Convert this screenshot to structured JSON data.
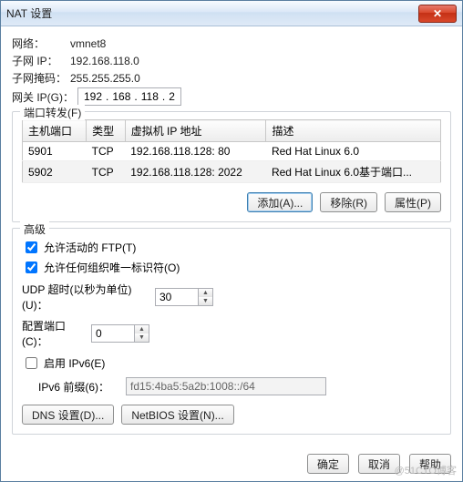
{
  "window": {
    "title": "NAT 设置"
  },
  "network_label": "网络：",
  "network_value": "vmnet8",
  "subnet_ip_label": "子网 IP：",
  "subnet_ip_value": "192.168.118.0",
  "subnet_mask_label": "子网掩码：",
  "subnet_mask_value": "255.255.255.0",
  "gateway_label": "网关 IP(G)：",
  "gateway_parts": {
    "a": "192",
    "b": "168",
    "c": "118",
    "d": "2"
  },
  "port_forward": {
    "group": "端口转发(F)",
    "headers": {
      "host_port": "主机端口",
      "type": "类型",
      "vm_ip": "虚拟机 IP 地址",
      "desc": "描述"
    },
    "rows": [
      {
        "host_port": "5901",
        "type": "TCP",
        "vm_ip": "192.168.118.128: 80",
        "desc": "Red Hat Linux 6.0"
      },
      {
        "host_port": "5902",
        "type": "TCP",
        "vm_ip": "192.168.118.128: 2022",
        "desc": "Red Hat Linux 6.0基于端口..."
      }
    ],
    "buttons": {
      "add": "添加(A)...",
      "remove": "移除(R)",
      "props": "属性(P)"
    }
  },
  "advanced": {
    "group": "高级",
    "allow_ftp": "允许活动的 FTP(T)",
    "allow_ftp_checked": true,
    "allow_org": "允许任何组织唯一标识符(O)",
    "allow_org_checked": true,
    "udp_label": "UDP 超时(以秒为单位)(U)：",
    "udp_value": "30",
    "cfg_port_label": "配置端口(C)：",
    "cfg_port_value": "0",
    "enable_ipv6": "启用 IPv6(E)",
    "enable_ipv6_checked": false,
    "ipv6_prefix_label": "IPv6 前缀(6)：",
    "ipv6_prefix_value": "fd15:4ba5:5a2b:1008::/64",
    "dns_btn": "DNS 设置(D)...",
    "netbios_btn": "NetBIOS 设置(N)..."
  },
  "footer": {
    "ok": "确定",
    "cancel": "取消",
    "help": "帮助"
  },
  "watermark": "@51CTO博客"
}
